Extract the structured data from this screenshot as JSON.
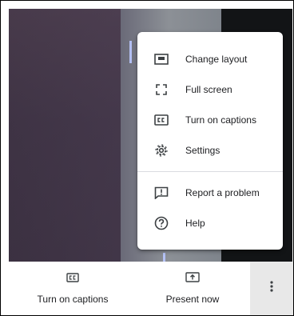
{
  "menu": {
    "items": [
      {
        "label": "Change layout",
        "icon": "layout-icon"
      },
      {
        "label": "Full screen",
        "icon": "fullscreen-icon"
      },
      {
        "label": "Turn on captions",
        "icon": "captions-icon"
      },
      {
        "label": "Settings",
        "icon": "gear-icon"
      },
      {
        "label": "Report a problem",
        "icon": "report-problem-icon"
      },
      {
        "label": "Help",
        "icon": "help-icon"
      }
    ]
  },
  "toolbar": {
    "captions_label": "Turn on captions",
    "captions_icon_text": "CC",
    "present_label": "Present now",
    "more_icon": "more-vert-icon"
  },
  "colors": {
    "icon": "#3c4043",
    "text": "#202124",
    "divider": "#dadce0",
    "more_bg": "#e8e8e8"
  }
}
